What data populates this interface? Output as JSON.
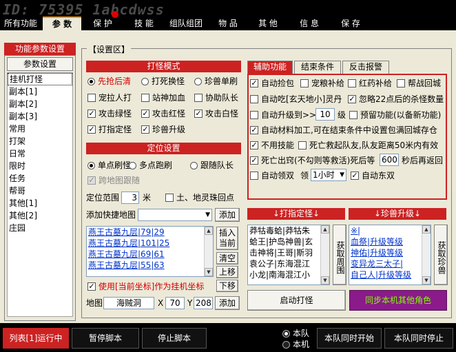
{
  "watermark": "ID: 75395 1abcdwss",
  "menu": [
    {
      "label": "所有功能"
    },
    {
      "label": "参 数"
    },
    {
      "label": "保 护"
    },
    {
      "label": "技 能"
    },
    {
      "label": "组队组团"
    },
    {
      "label": "物 品"
    },
    {
      "label": "其 他"
    },
    {
      "label": "信 息"
    },
    {
      "label": "保 存"
    }
  ],
  "left_panel": {
    "title": "功能参数设置",
    "param_button": "参数设置",
    "items": [
      "挂机打怪",
      "副本[1]",
      "副本[2]",
      "副本[3]",
      "常用",
      "打架",
      "日常",
      "限时",
      "任务",
      "帮哥",
      "其他[1]",
      "其他[2]",
      "庄园"
    ],
    "selected": "挂机打怪"
  },
  "settings": {
    "legend": "【设置区】",
    "fight_mode": {
      "header": "打怪模式",
      "radios": [
        "先抢后清",
        "打死换怪",
        "珍兽单刷"
      ],
      "checks_row1": [
        "宠拉人打",
        "站神加血",
        "协助队长"
      ],
      "checks_row2": [
        "攻击绿怪",
        "攻击红怪",
        "攻击白怪"
      ],
      "checks_row3": [
        "打指定怪",
        "珍兽升级"
      ]
    },
    "position": {
      "header": "定位设置",
      "radios": [
        "单点刷怪",
        "多点跑刷",
        "跟随队长"
      ],
      "cross_map": "跨地图跟随",
      "range_label": "定位范围",
      "range_value": "3",
      "range_unit": "米",
      "earth_spirit": "土、地灵珠回点",
      "add_map_label": "添加快捷地图",
      "add_button": "添加",
      "coords": [
        "燕王古墓九层|79|29",
        "燕王古墓九层|101|25",
        "燕王古墓九层|69|61",
        "燕王古墓九层|55|63"
      ],
      "insert_button": "插入当前",
      "clear_button": "清空",
      "up_button": "上移",
      "down_button": "下移",
      "use_current": "使用[当前坐标]作为挂机坐标",
      "map_label": "地图",
      "map_value": "海贼洞",
      "x_label": "X",
      "x_value": "70",
      "y_label": "Y",
      "y_value": "208",
      "add2_button": "添加"
    },
    "tabs": [
      "辅助功能",
      "结束条件",
      "反击报警"
    ],
    "aux": {
      "row1": [
        "自动捡包",
        "宠粮补给",
        "红药补给",
        "帮战回城"
      ],
      "row2_a": "自动吃[玄天地小]灵丹",
      "row2_b": "忽略22点后的杀怪数量",
      "row3_a": "自动升级到>>",
      "row3_value": "10",
      "row3_unit": "级",
      "row3_b": "预留功能(以备新功能)",
      "row4": "自动材料加工,可在结束条件中设置包满回城存仓",
      "row5_a": "不用技能",
      "row5_b": "死亡救起队友,队友距离50米内有效",
      "row6_a": "死亡出窍(不勾则等救活)死后等",
      "row6_value": "600",
      "row6_b": "秒后再返回",
      "row7_a": "自动领双",
      "row7_b": "领",
      "row7_select": "1小时",
      "row7_c": "自动东双"
    },
    "target_monster": {
      "header": "↓打指定怪↓",
      "items": [
        "莽牯毒蛤|莽牯朱",
        "蛤王|护岛神兽|玄",
        "击神将|王哥|斯羽",
        "袁公子|东海混江",
        "小龙|南海混江小"
      ],
      "fetch_button": "获取周围"
    },
    "pet_level": {
      "header": "↓珍兽升级↓",
      "items": [
        "※|",
        "血祭|升级等级",
        "神佑|升级等级",
        "变异龙三太子|",
        "自己人|升级等级"
      ],
      "fetch_button": "获取珍兽"
    },
    "start_button": "启动打怪",
    "sync_button": "同步本机其他角色"
  },
  "bottom": {
    "list_run": "列表[1]运行中",
    "pause": "暂停脚本",
    "stop": "停止脚本",
    "radio_team": "本队",
    "radio_local": "本机",
    "team_start": "本队同时开始",
    "team_stop": "本队同时停止"
  },
  "colors": {
    "accent_red": "#cc2222",
    "sync_purple": "#8b1a8b",
    "sync_text": "#7fff00"
  }
}
